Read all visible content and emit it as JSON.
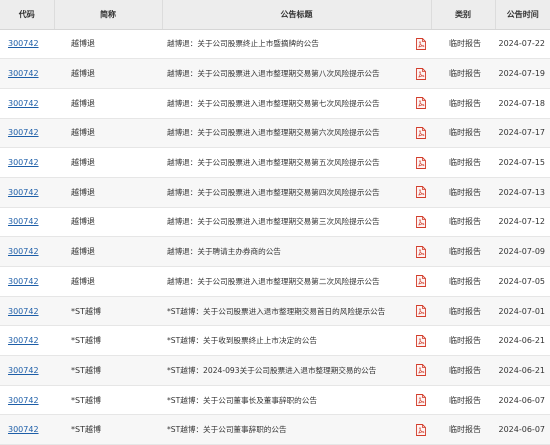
{
  "headers": {
    "code": "代码",
    "name": "简称",
    "title": "公告标题",
    "type": "类别",
    "date": "公告时间"
  },
  "rows": [
    {
      "code": "300742",
      "name": "越博退",
      "title": "越博退：关于公司股票终止上市暨摘牌的公告",
      "type": "临时报告",
      "date": "2024-07-22"
    },
    {
      "code": "300742",
      "name": "越博退",
      "title": "越博退：关于公司股票进入退市整理期交易第八次风险提示公告",
      "type": "临时报告",
      "date": "2024-07-19"
    },
    {
      "code": "300742",
      "name": "越博退",
      "title": "越博退：关于公司股票进入退市整理期交易第七次风险提示公告",
      "type": "临时报告",
      "date": "2024-07-18"
    },
    {
      "code": "300742",
      "name": "越博退",
      "title": "越博退：关于公司股票进入退市整理期交易第六次风险提示公告",
      "type": "临时报告",
      "date": "2024-07-17"
    },
    {
      "code": "300742",
      "name": "越博退",
      "title": "越博退：关于公司股票进入退市整理期交易第五次风险提示公告",
      "type": "临时报告",
      "date": "2024-07-15"
    },
    {
      "code": "300742",
      "name": "越博退",
      "title": "越博退：关于公司股票进入退市整理期交易第四次风险提示公告",
      "type": "临时报告",
      "date": "2024-07-13"
    },
    {
      "code": "300742",
      "name": "越博退",
      "title": "越博退：关于公司股票进入退市整理期交易第三次风险提示公告",
      "type": "临时报告",
      "date": "2024-07-12"
    },
    {
      "code": "300742",
      "name": "越博退",
      "title": "越博退：关于聘请主办券商的公告",
      "type": "临时报告",
      "date": "2024-07-09"
    },
    {
      "code": "300742",
      "name": "越博退",
      "title": "越博退：关于公司股票进入退市整理期交易第二次风险提示公告",
      "type": "临时报告",
      "date": "2024-07-05"
    },
    {
      "code": "300742",
      "name": "*ST越博",
      "title": "*ST越博：关于公司股票进入退市整理期交易首日的风险提示公告",
      "type": "临时报告",
      "date": "2024-07-01"
    },
    {
      "code": "300742",
      "name": "*ST越博",
      "title": "*ST越博：关于收到股票终止上市决定的公告",
      "type": "临时报告",
      "date": "2024-06-21"
    },
    {
      "code": "300742",
      "name": "*ST越博",
      "title": "*ST越博：2024-093关于公司股票进入退市整理期交易的公告",
      "type": "临时报告",
      "date": "2024-06-21"
    },
    {
      "code": "300742",
      "name": "*ST越博",
      "title": "*ST越博：关于公司董事长及董事辞职的公告",
      "type": "临时报告",
      "date": "2024-06-07"
    },
    {
      "code": "300742",
      "name": "*ST越博",
      "title": "*ST越博：关于公司董事辞职的公告",
      "type": "临时报告",
      "date": "2024-06-07"
    }
  ],
  "icons": {
    "pdf": "pdf-file-icon"
  },
  "colors": {
    "header_bg": "#ededed",
    "link": "#1d5ea8",
    "pdf_red": "#d23c2a",
    "stripe": "#f7f7f7"
  }
}
